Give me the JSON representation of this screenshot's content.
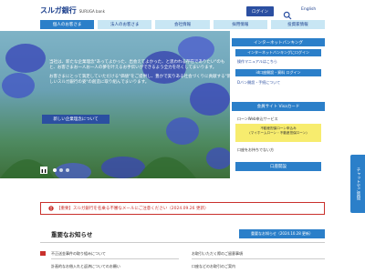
{
  "header": {
    "logo_jp": "スルガ銀行",
    "logo_en": "SURUGA bank",
    "login_label": "ログイン",
    "english_label": "English"
  },
  "nav": {
    "tabs": [
      {
        "label": "個人のお客さま"
      },
      {
        "label": "法人のお客さま"
      },
      {
        "label": "会社情報"
      },
      {
        "label": "採用情報"
      },
      {
        "label": "投資家情報"
      }
    ]
  },
  "hero": {
    "paragraph1": "当社は、新たな企業理念\"あってよかった、出会えてよかった、と思われる存在でありたい\"のもと、お客さまお一人お一人の夢を叶えるお手伝いができるよう全力を尽くしてまいります。",
    "paragraph2": "お客さまにとって満足していただける\"価値\"をご提供し、豊かで実りある社会づくりに貢献する\"新しいスルガ銀行の姿\"の創造に取り組んでまいります。",
    "about_button": "新しい企業理念について"
  },
  "panel": {
    "ib_header": "インターネットバンキング",
    "login_button": "インターネットバンキングにログイン",
    "manual_link": "操作マニュアルはこちら",
    "id_button": "id口座開設・資料 ログイン",
    "docs_link": "Dバン開設・手続について",
    "member_button": "会員サイト Visaカード",
    "loan_title": "ローンWeb申込サービス",
    "loan_box_line1": "不動産担保ローン申込み",
    "loan_box_line2": "(マイホームローン・不動産担保ローン)",
    "account_title": "口座をお持ちでない方",
    "account_button": "口座開設"
  },
  "chat": {
    "label": "チャットでご質問"
  },
  "alert": {
    "text": "【重要】スルガ銀行を名乗る不審なメールにご注意ください（2024.09.26 更新）"
  },
  "news": {
    "title": "重要なお知らせ",
    "all_button": "重要なお知らせ（2024.10.28 更新）",
    "items": [
      {
        "text": "不正送金事件の取り組みについて"
      },
      {
        "text": "お取引いただく際のご留意事項"
      },
      {
        "text": "計画的なお借入れと返済についてのお願い"
      },
      {
        "text": "口座などのお取引のご案内"
      }
    ]
  }
}
